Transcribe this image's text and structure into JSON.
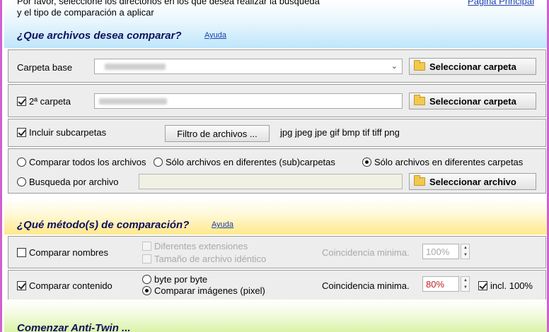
{
  "header": {
    "intro_line1": "Por favor, seleccione los directorios en los que desea realizar la búsqueda",
    "intro_line2": "y el tipo de comparación a aplicar",
    "main_link": "Página Principal"
  },
  "files_section": {
    "title": "¿Que archivos desea comparar?",
    "help": "Ayuda",
    "base_folder_label": "Carpeta base",
    "select_folder_label": "Seleccionar carpeta",
    "second_folder_label": "2ª carpeta",
    "second_folder_checked": true,
    "include_subfolders_label": "Incluir subcarpetas",
    "include_subfolders_checked": true,
    "file_filter_button": "Filtro de archivos ...",
    "file_extensions": "jpg jpeg jpe gif bmp tif tiff png",
    "radio_compare_all": "Comparar todos los archivos",
    "radio_only_diff_sub": "Sólo archivos en diferentes (sub)carpetas",
    "radio_only_diff_folders": "Sólo archivos en diferentes carpetas",
    "radio_search_by_file": "Busqueda por archivo",
    "select_file_label": "Seleccionar archivo"
  },
  "method_section": {
    "title": "¿Qué método(s) de comparación?",
    "help": "Ayuda",
    "compare_names_label": "Comparar nombres",
    "compare_names_checked": false,
    "diff_extensions_label": "Diferentes extensiones",
    "identical_size_label": "Tamaño de archivo idéntico",
    "name_min_match_label": "Coincidencia minima.",
    "name_min_match_value": "100%",
    "compare_content_label": "Comparar contenido",
    "compare_content_checked": true,
    "byte_by_byte_label": "byte por byte",
    "compare_images_label": "Comparar imágenes (pixel)",
    "content_min_match_label": "Coincidencia minima.",
    "content_min_match_value": "80%",
    "incl_100_label": "incl. 100%",
    "incl_100_checked": true
  },
  "start_section": {
    "title": "Comenzar Anti-Twin ..."
  },
  "colors": {
    "section_title": "#101060",
    "link": "#1a3fb0",
    "window_border": "#d060d0",
    "min_match_value": "#c02020"
  },
  "icons": [
    "folder-icon",
    "chevron-down-icon",
    "spin-up-icon",
    "spin-down-icon"
  ]
}
